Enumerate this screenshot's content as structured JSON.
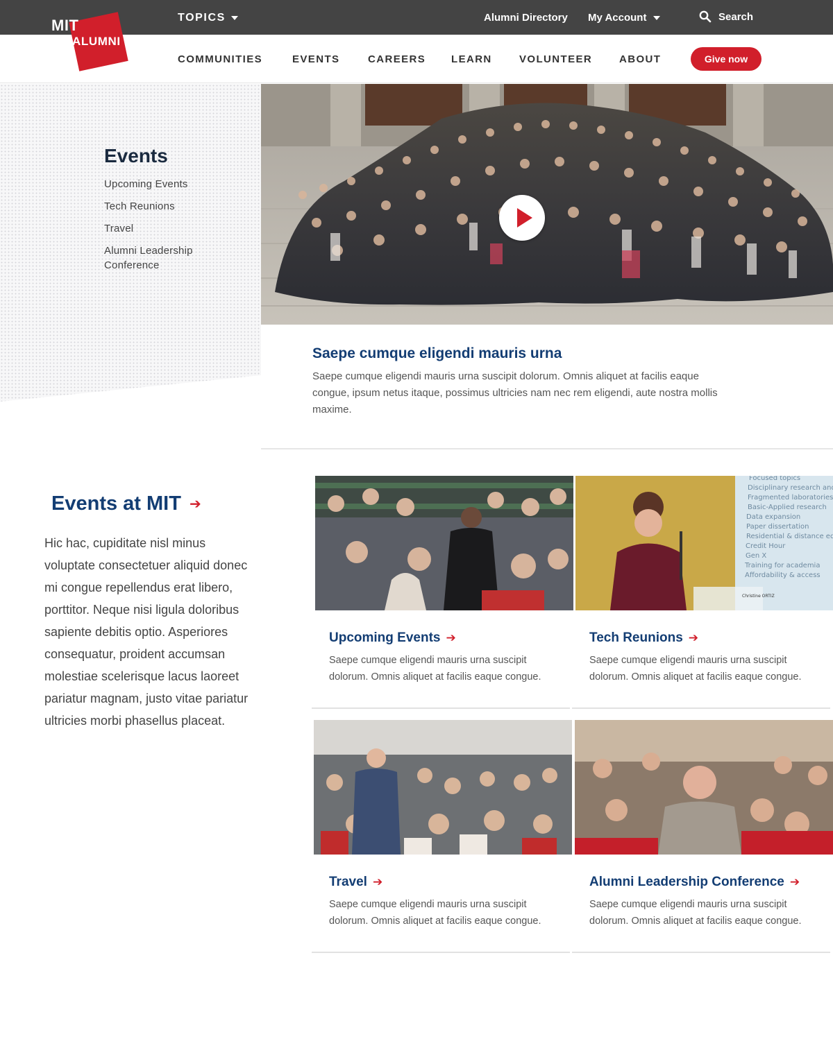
{
  "header": {
    "topics_label": "TOPICS",
    "alumni_directory": "Alumni Directory",
    "my_account": "My Account",
    "search": "Search",
    "logo_top": "MIT",
    "logo_bottom": "ALUMNI"
  },
  "nav": {
    "items": [
      "COMMUNITIES",
      "EVENTS",
      "CAREERS",
      "LEARN",
      "VOLUNTEER",
      "ABOUT"
    ],
    "give_label": "Give now"
  },
  "sidebar": {
    "title": "Events",
    "links": [
      "Upcoming Events",
      "Tech Reunions",
      "Travel",
      "Alumni Leadership Conference"
    ]
  },
  "feature": {
    "title": "Saepe cumque eligendi mauris urna",
    "description": "Saepe cumque eligendi mauris urna suscipit dolorum. Omnis aliquet at facilis eaque congue, ipsum netus itaque, possimus ultricies nam nec rem eligendi, aute nostra mollis maxime."
  },
  "events_at_mit": {
    "title": "Events at MIT",
    "body": "Hic hac, cupiditate nisl minus voluptate consectetuer aliquid donec mi congue repellendus erat libero, porttitor. Neque nisi ligula doloribus sapiente debitis optio. Asperiores consequatur, proident accumsan molestiae scelerisque lacus laoreet pariatur magnam, justo vitae pariatur ultricies morbi phasellus placeat."
  },
  "cards": [
    {
      "title": "Upcoming Events",
      "description": "Saepe cumque eligendi mauris urna suscipit dolorum. Omnis aliquet at facilis eaque congue."
    },
    {
      "title": "Tech Reunions",
      "description": "Saepe cumque eligendi mauris urna suscipit dolorum. Omnis aliquet at facilis eaque congue."
    },
    {
      "title": "Travel",
      "description": "Saepe cumque eligendi mauris urna suscipit dolorum. Omnis aliquet at facilis eaque congue."
    },
    {
      "title": "Alumni Leadership Conference",
      "description": "Saepe cumque eligendi mauris urna suscipit dolorum. Omnis aliquet at facilis eaque congue."
    }
  ],
  "slide_text": [
    "Focused topics",
    "Disciplinary research and skills",
    "Fragmented laboratories",
    "Basic-Applied research",
    "Data expansion",
    "Paper dissertation",
    "Residential & distance education",
    "Credit Hour",
    "Gen X",
    "Training for academia",
    "Affordability & access"
  ],
  "podium_sign": "Christine ORTIZ",
  "colors": {
    "brand_red": "#d11f2b",
    "navy": "#133d73",
    "topbar": "#444444"
  },
  "icons": [
    "search-icon",
    "caret-down-icon",
    "play-icon",
    "arrow-right-icon"
  ]
}
